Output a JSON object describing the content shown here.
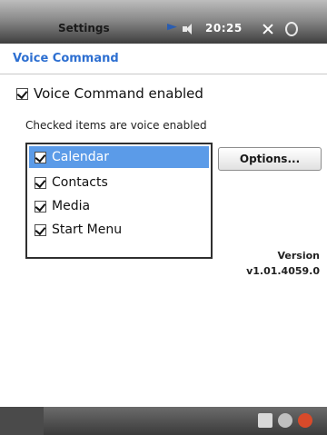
{
  "title_bar": {
    "app_title": "Settings",
    "clock": "20:25"
  },
  "header": {
    "title": "Voice Command"
  },
  "settings": {
    "enabled_label": "Voice Command enabled",
    "enabled_checked": true,
    "list_caption": "Checked items are voice enabled"
  },
  "list": {
    "items": [
      {
        "label": "Calendar",
        "checked": true,
        "selected": true
      },
      {
        "label": "Contacts",
        "checked": true,
        "selected": false
      },
      {
        "label": "Media",
        "checked": true,
        "selected": false
      },
      {
        "label": "Start Menu",
        "checked": true,
        "selected": false
      }
    ]
  },
  "buttons": {
    "options_label": "Options..."
  },
  "version": {
    "label": "Version",
    "value": "v1.01.4059.0"
  },
  "colors": {
    "accent": "#2d6fd1",
    "selection": "#5b9be8"
  },
  "icons": {
    "topbar": [
      "flag-icon",
      "speaker-icon",
      "close-icon",
      "ok-icon"
    ],
    "bottombar": [
      "keyboard-icon",
      "network-icon",
      "alert-icon"
    ]
  }
}
